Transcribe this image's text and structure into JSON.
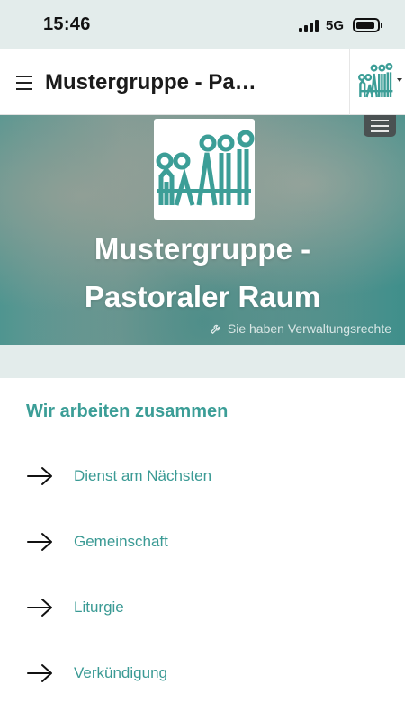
{
  "status_bar": {
    "time": "15:46",
    "network": "5G"
  },
  "header": {
    "title": "Mustergruppe - Pastoraler Raum"
  },
  "hero": {
    "title_line1": "Mustergruppe -",
    "title_line2": "Pastoraler Raum",
    "admin_note": "Sie haben Verwaltungsrechte"
  },
  "section": {
    "title": "Wir arbeiten zusammen",
    "links": [
      {
        "label": "Dienst am Nächsten"
      },
      {
        "label": "Gemeinschaft"
      },
      {
        "label": "Liturgie"
      },
      {
        "label": "Verkündigung"
      }
    ]
  },
  "colors": {
    "accent": "#3c9e97",
    "hero_teal": "#4f9590",
    "background": "#e3eceb"
  },
  "icons": [
    "hamburger-menu-icon",
    "group-logo-icon",
    "wrench-icon",
    "arrow-right-icon",
    "signal-icon",
    "battery-icon"
  ]
}
